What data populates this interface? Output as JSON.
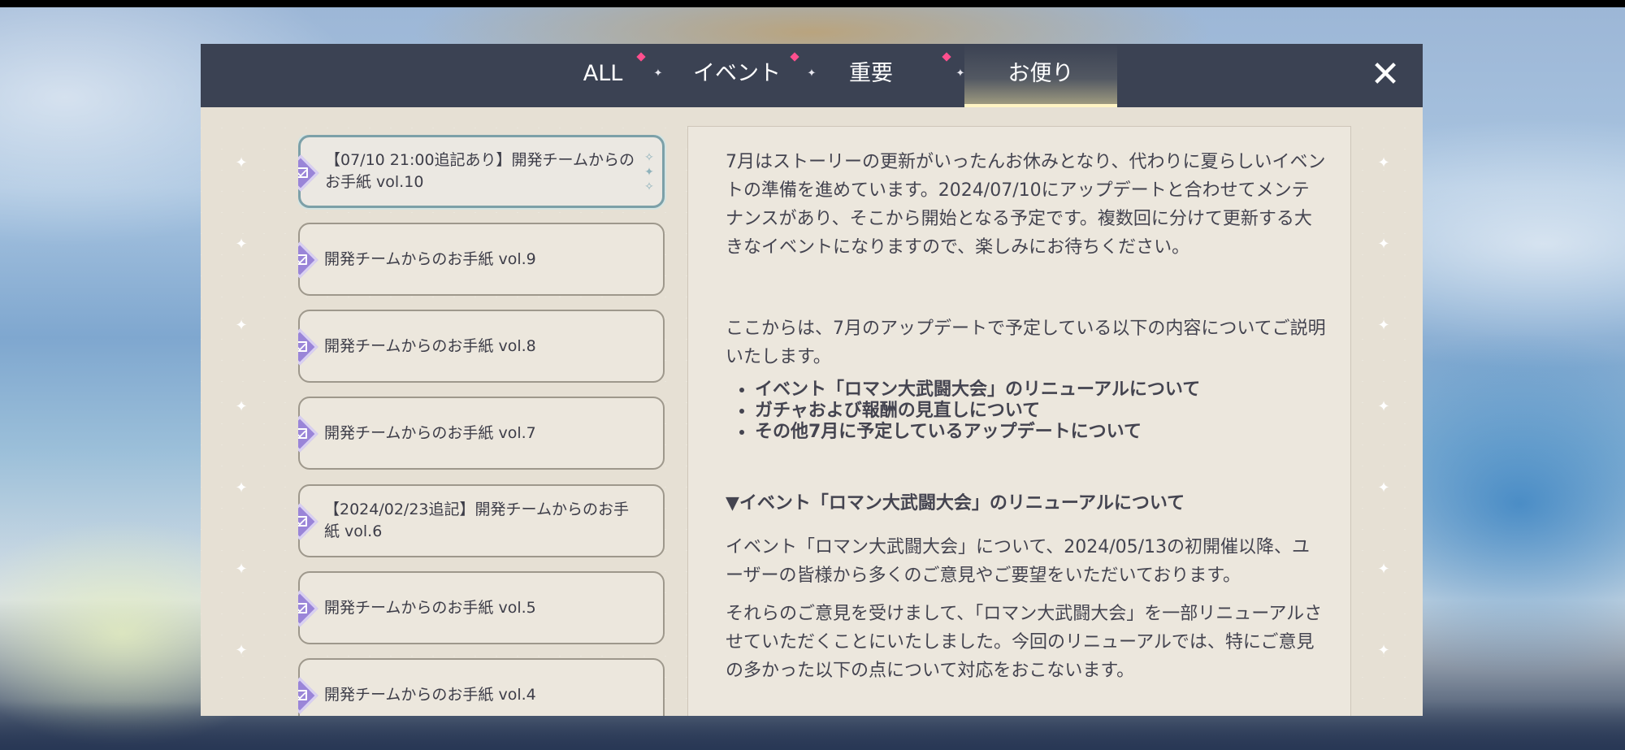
{
  "tabs": {
    "all": "ALL",
    "event": "イベント",
    "important": "重要",
    "letter": "お便り",
    "active": "お便り",
    "close_icon": "close-icon",
    "badge_color": "#ff4f8e"
  },
  "letters": [
    {
      "title": "【07/10 21:00追記あり】開発チームからのお手紙 vol.10",
      "selected": true
    },
    {
      "title": "開発チームからのお手紙 vol.9",
      "selected": false
    },
    {
      "title": "開発チームからのお手紙 vol.8",
      "selected": false
    },
    {
      "title": "開発チームからのお手紙 vol.7",
      "selected": false
    },
    {
      "title": "【2024/02/23追記】開発チームからのお手紙 vol.6",
      "selected": false
    },
    {
      "title": "開発チームからのお手紙 vol.5",
      "selected": false
    },
    {
      "title": "開発チームからのお手紙 vol.4",
      "selected": false
    }
  ],
  "content": {
    "intro": "7月はストーリーの更新がいったんお休みとなり、代わりに夏らしいイベントの準備を進めています。2024/07/10にアップデートと合わせてメンテナンスがあり、そこから開始となる予定です。複数回に分けて更新する大きなイベントになりますので、楽しみにお待ちください。",
    "lead": "ここからは、7月のアップデートで予定している以下の内容についてご説明いたします。",
    "bullets": [
      "イベント「ロマン大武闘大会」のリニューアルについて",
      "ガチャおよび報酬の見直しについて",
      "その他7月に予定しているアップデートについて"
    ],
    "section_heading": "▼イベント「ロマン大武闘大会」のリニューアルについて",
    "para1": "イベント「ロマン大武闘大会」について、2024/05/13の初開催以降、ユーザーの皆様から多くのご意見やご要望をいただいております。",
    "para2": "それらのご意見を受けまして、「ロマン大武闘大会」を一部リニューアルさせていただくことにいたしました。今回のリニューアルでは、特にご意見の多かった以下の点について対応をおこないます。"
  }
}
